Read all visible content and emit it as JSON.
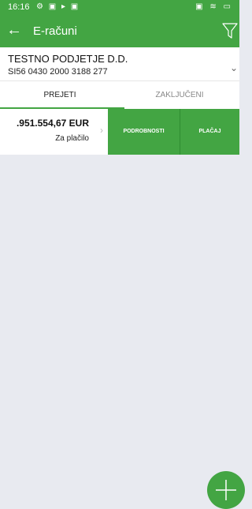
{
  "status_bar": {
    "time": "16:16",
    "left_icons": "⚙ ▣ ▸ ▣",
    "right_icons": "▣ ≋ ▭"
  },
  "app_bar": {
    "title": "E-računi"
  },
  "account": {
    "name": "TESTNO PODJETJE D.D.",
    "iban": "SI56 0430 2000 3188 277"
  },
  "tabs": [
    {
      "label": "PREJETI"
    },
    {
      "label": "ZAKLJUČENI"
    }
  ],
  "invoices": [
    {
      "amount": ".951.554,67 EUR",
      "status": "Za plačilo",
      "details_label": "PODROBNOSTI",
      "pay_label": "PLAČAJ"
    }
  ],
  "colors": {
    "brand": "#43a543",
    "background": "#e8eaf0"
  }
}
